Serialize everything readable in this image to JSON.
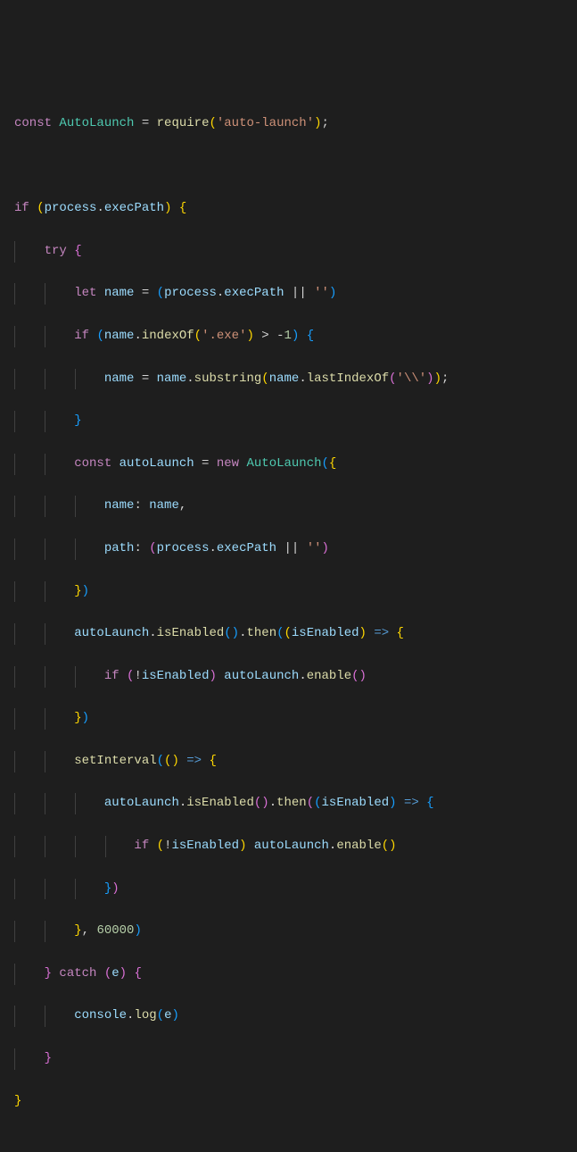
{
  "code": {
    "l1": {
      "kw_const": "const",
      "var_al": "AutoLaunch",
      "eq": " = ",
      "fn_require": "require",
      "p_o": "(",
      "str": "'auto-launch'",
      "p_c": ")",
      "semi": ";"
    },
    "l2": "",
    "l3": {
      "kw_if": "if",
      "sp": " ",
      "p_o": "(",
      "var_process": "process",
      "dot": ".",
      "prop_execPath": "execPath",
      "p_c": ")",
      "sp2": " ",
      "brace_o": "{"
    },
    "l4": {
      "indent": "    ",
      "kw_try": "try",
      "sp": " ",
      "brace_o": "{"
    },
    "l5": {
      "indent": "        ",
      "kw_let": "let",
      "sp": " ",
      "var_name": "name",
      "eq": " = ",
      "p_o": "(",
      "var_process": "process",
      "dot": ".",
      "prop_execPath": "execPath",
      "or": " || ",
      "str": "''",
      "p_c": ")"
    },
    "l6": {
      "indent": "        ",
      "kw_if": "if",
      "sp": " ",
      "p_o": "(",
      "var_name": "name",
      "dot": ".",
      "fn_indexOf": "indexOf",
      "p_o2": "(",
      "str": "'.exe'",
      "p_c2": ")",
      "gt": " > ",
      "num": "-",
      "num2": "1",
      "p_c": ")",
      "sp2": " ",
      "brace_o": "{"
    },
    "l7": {
      "indent": "            ",
      "var_name": "name",
      "eq": " = ",
      "var_name2": "name",
      "dot": ".",
      "fn_substring": "substring",
      "p_o": "(",
      "var_name3": "name",
      "dot2": ".",
      "fn_lastIndexOf": "lastIndexOf",
      "p_o2": "(",
      "str": "'\\\\'",
      "p_c2": ")",
      "p_c": ")",
      "semi": ";"
    },
    "l8": {
      "indent": "        ",
      "brace_c": "}"
    },
    "l9": {
      "indent": "        ",
      "kw_const": "const",
      "sp": " ",
      "var_autoLaunch": "autoLaunch",
      "eq": " = ",
      "kw_new": "new",
      "sp2": " ",
      "cls_AutoLaunch": "AutoLaunch",
      "p_o": "(",
      "brace_o": "{"
    },
    "l10": {
      "indent": "            ",
      "prop_name": "name",
      "colon": ": ",
      "var_name": "name",
      "comma": ","
    },
    "l11": {
      "indent": "            ",
      "prop_path": "path",
      "colon": ": ",
      "p_o": "(",
      "var_process": "process",
      "dot": ".",
      "prop_execPath": "execPath",
      "or": " || ",
      "str": "''",
      "p_c": ")"
    },
    "l12": {
      "indent": "        ",
      "brace_c": "}",
      "p_c": ")"
    },
    "l13": {
      "indent": "        ",
      "var_autoLaunch": "autoLaunch",
      "dot": ".",
      "fn_isEnabled": "isEnabled",
      "p_o": "(",
      "p_c": ")",
      "dot2": ".",
      "fn_then": "then",
      "p_o2": "(",
      "p_o3": "(",
      "var_isEnabled": "isEnabled",
      "p_c3": ")",
      "arrow": " => ",
      "brace_o": "{"
    },
    "l14": {
      "indent": "            ",
      "kw_if": "if",
      "sp": " ",
      "p_o": "(",
      "not": "!",
      "var_isEnabled": "isEnabled",
      "p_c": ")",
      "sp2": " ",
      "var_autoLaunch": "autoLaunch",
      "dot": ".",
      "fn_enable": "enable",
      "p_o2": "(",
      "p_c2": ")"
    },
    "l15": {
      "indent": "        ",
      "brace_c": "}",
      "p_c": ")"
    },
    "l16": {
      "indent": "        ",
      "fn_setInterval": "setInterval",
      "p_o": "(",
      "p_o2": "(",
      "p_c2": ")",
      "arrow": " => ",
      "brace_o": "{"
    },
    "l17": {
      "indent": "            ",
      "var_autoLaunch": "autoLaunch",
      "dot": ".",
      "fn_isEnabled": "isEnabled",
      "p_o": "(",
      "p_c": ")",
      "dot2": ".",
      "fn_then": "then",
      "p_o2": "(",
      "p_o3": "(",
      "var_isEnabled": "isEnabled",
      "p_c3": ")",
      "arrow": " => ",
      "brace_o": "{"
    },
    "l18": {
      "indent": "                ",
      "kw_if": "if",
      "sp": " ",
      "p_o": "(",
      "not": "!",
      "var_isEnabled": "isEnabled",
      "p_c": ")",
      "sp2": " ",
      "var_autoLaunch": "autoLaunch",
      "dot": ".",
      "fn_enable": "enable",
      "p_o2": "(",
      "p_c2": ")"
    },
    "l19": {
      "indent": "            ",
      "brace_c": "}",
      "p_c": ")"
    },
    "l20": {
      "indent": "        ",
      "brace_c": "}",
      "comma": ", ",
      "num": "60000",
      "p_c": ")"
    },
    "l21": {
      "indent": "    ",
      "brace_c": "}",
      "sp": " ",
      "kw_catch": "catch",
      "sp2": " ",
      "p_o": "(",
      "var_e": "e",
      "p_c": ")",
      "sp3": " ",
      "brace_o": "{"
    },
    "l22": {
      "indent": "        ",
      "var_console": "console",
      "dot": ".",
      "fn_log": "log",
      "p_o": "(",
      "var_e": "e",
      "p_c": ")"
    },
    "l23": {
      "indent": "    ",
      "brace_c": "}"
    },
    "l24": {
      "brace_c": "}"
    }
  }
}
